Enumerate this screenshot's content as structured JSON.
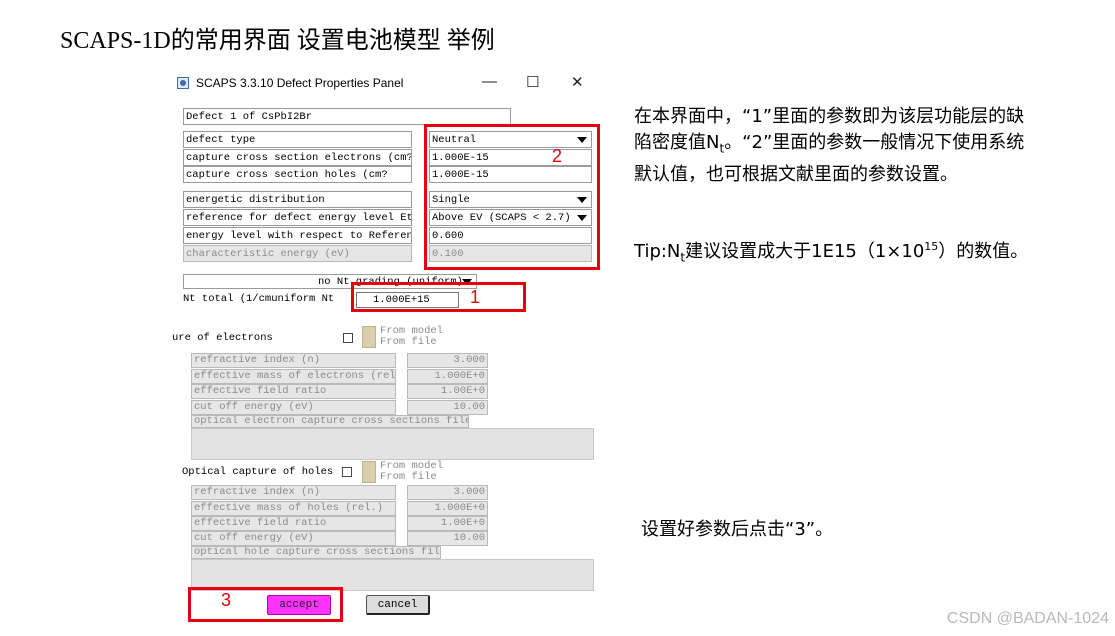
{
  "slide": {
    "title": "SCAPS-1D的常用界面 设置电池模型 举例",
    "watermark": "CSDN @BADAN-1024"
  },
  "window": {
    "title": "SCAPS 3.3.10 Defect Properties Panel",
    "minimize_glyph": "—",
    "maximize_glyph": "☐",
    "close_glyph": "✕"
  },
  "defect": {
    "name": "Defect 1 of CsPbI2Br",
    "fields": [
      {
        "label": "defect type",
        "value": "Neutral",
        "kind": "dropdown"
      },
      {
        "label": "capture cross section electrons (cm?",
        "value": "1.000E-15",
        "kind": "input"
      },
      {
        "label": "capture cross section holes (cm?",
        "value": "1.000E-15",
        "kind": "input"
      },
      {
        "label": "energetic distribution",
        "value": "Single",
        "kind": "dropdown"
      },
      {
        "label": "reference for defect energy level Et",
        "value": "Above EV (SCAPS < 2.7)",
        "kind": "dropdown"
      },
      {
        "label": "energy level with respect to Referenc",
        "value": "0.600",
        "kind": "input"
      },
      {
        "label": "characteristic energy (eV)",
        "value": "0.100",
        "kind": "disabled"
      }
    ],
    "grading_select": "no Nt grading (uniform)",
    "nt_total_label": "Nt total (1/cmuniform Nt",
    "nt_total_value": "1.000E+15"
  },
  "optical_electrons": {
    "title": "ure of electrons",
    "from_model": "From model",
    "from_file": "From file",
    "rows": [
      {
        "label": "refractive index (n)",
        "value": "3.000"
      },
      {
        "label": "effective mass of electrons (rel.",
        "value": "1.000E+0"
      },
      {
        "label": "effective field ratio",
        "value": "1.00E+0"
      },
      {
        "label": "cut off energy (eV)",
        "value": "10.00"
      }
    ],
    "file_label": "optical electron capture cross sections file:"
  },
  "optical_holes": {
    "title": "Optical capture of holes",
    "from_model": "From model",
    "from_file": "From file",
    "rows": [
      {
        "label": "refractive index (n)",
        "value": "3.000"
      },
      {
        "label": "effective mass of holes (rel.)",
        "value": "1.000E+0"
      },
      {
        "label": "effective field ratio",
        "value": "1.00E+0"
      },
      {
        "label": "cut off energy (eV)",
        "value": "10.00"
      }
    ],
    "file_label": "optical hole capture cross sections file:"
  },
  "buttons": {
    "accept": "accept",
    "cancel": "cancel"
  },
  "annotations": {
    "n1": "1",
    "n2": "2",
    "n3": "3",
    "color": "#e8000b"
  },
  "notes": {
    "p1_a": "在本界面中，“1”里面的参数即为该层功能层的缺陷密度值N",
    "p1_sub": "t",
    "p1_b": "。“2”里面的参数一般情况下使用系统默认值，也可根据文献里面的参数设置。",
    "p2_a": "Tip:N",
    "p2_sub": "t",
    "p2_b": "建议设置成大于1E15（1×10",
    "p2_sup": "15",
    "p2_c": "）的数值。",
    "p3": "设置好参数后点击“3”。"
  }
}
